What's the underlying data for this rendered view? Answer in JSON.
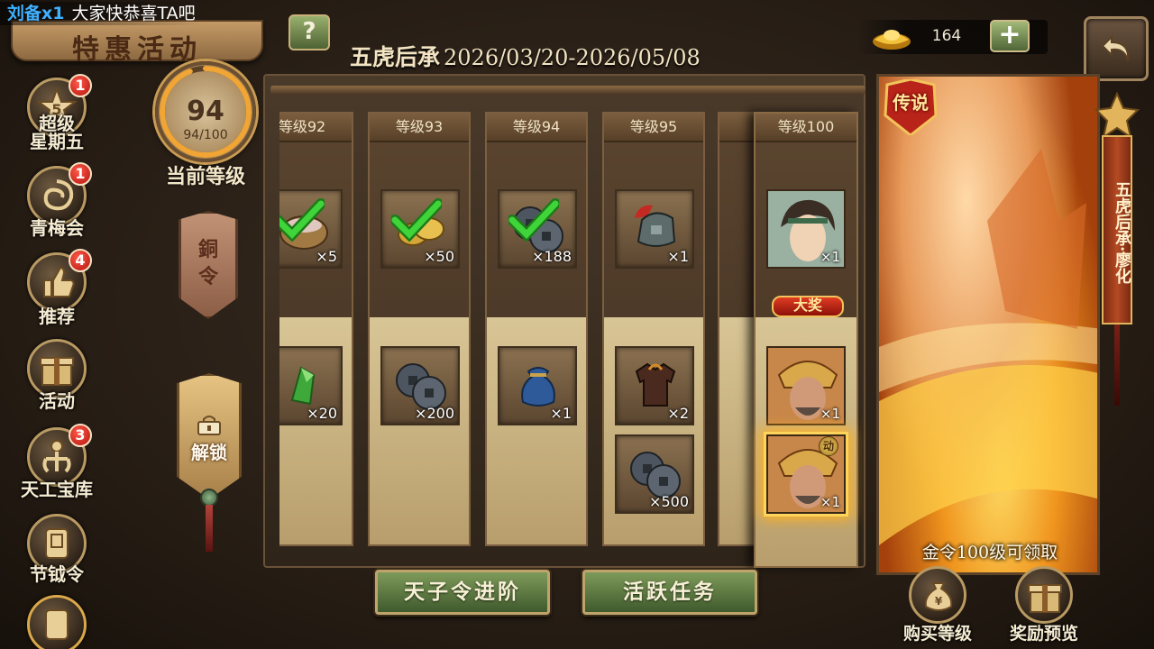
{
  "broadcast": {
    "name": "刘备x1",
    "message": "大家快恭喜TA吧"
  },
  "title_banner": "特惠活动",
  "help_label": "?",
  "activity": {
    "name": "五虎后承",
    "dates": "2026/03/20-2026/05/08"
  },
  "currency": {
    "icon": "gold-ingot-icon",
    "value": "164",
    "add_label": "+"
  },
  "sidebar": {
    "items": [
      {
        "label_line1": "超级",
        "label_line2": "星期五",
        "badge": "1",
        "icon": "star-five-icon"
      },
      {
        "label_line1": "青梅会",
        "label_line2": "",
        "badge": "1",
        "icon": "swirl-icon"
      },
      {
        "label_line1": "推荐",
        "label_line2": "",
        "badge": "4",
        "icon": "thumbs-up-icon"
      },
      {
        "label_line1": "活动",
        "label_line2": "",
        "badge": "",
        "icon": "gift-icon"
      },
      {
        "label_line1": "天工宝库",
        "label_line2": "",
        "badge": "3",
        "icon": "claw-icon"
      },
      {
        "label_line1": "节钺令",
        "label_line2": "",
        "badge": "",
        "icon": "seal-icon"
      }
    ]
  },
  "level": {
    "current": "94",
    "progress_text": "94/100",
    "progress_fraction": 0.94,
    "label": "当前等级"
  },
  "tokens": {
    "bronze_line1": "銅",
    "bronze_line2": "令",
    "unlock_label": "解锁"
  },
  "columns": [
    {
      "header": "等级92",
      "free_qty": "×5",
      "free_claimed": true,
      "paid_qty": "×20",
      "paid2_qty": ""
    },
    {
      "header": "等级93",
      "free_qty": "×50",
      "free_claimed": true,
      "paid_qty": "×200",
      "paid2_qty": ""
    },
    {
      "header": "等级94",
      "free_qty": "×188",
      "free_claimed": true,
      "paid_qty": "×1",
      "paid2_qty": ""
    },
    {
      "header": "等级95",
      "free_qty": "×1",
      "free_claimed": false,
      "paid_qty": "×2",
      "paid2_qty": "×500"
    }
  ],
  "final_column": {
    "header": "等级100",
    "free_qty": "×1",
    "grand_prize": "大奖",
    "paid_qty": "×1",
    "paid2_qty": "×1",
    "active_tag": "动"
  },
  "hero_preview": {
    "legend_tag": "传说",
    "claim_hint": "金令100级可领取",
    "banner_name": "五虎后承·廖化"
  },
  "buttons": {
    "advance": "天子令进阶",
    "tasks": "活跃任务",
    "buy_level": "购买等级",
    "reward_preview": "奖励预览"
  },
  "colors": {
    "accent_gold": "#c89b54",
    "button_green": "#5f7a43",
    "badge_red": "#d42a1e",
    "check_green": "#2fb52a",
    "broadcast_name": "#3fb0ff"
  }
}
